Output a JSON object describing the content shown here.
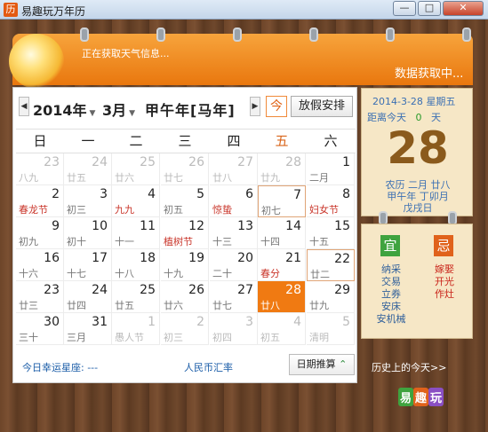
{
  "window": {
    "icon_char": "历",
    "title": "易趣玩万年历",
    "buttons": [
      "—",
      "□",
      "✕"
    ]
  },
  "header": {
    "weather_text": "正在获取天气信息...",
    "data_status": "数据获取中..."
  },
  "nav": {
    "year": "2014年",
    "month": "3月",
    "ganzhi": "甲午年[马年]",
    "prev": "◀",
    "next": "▶",
    "today_label": "今",
    "holiday_label": "放假安排"
  },
  "weekdays": [
    "日",
    "一",
    "二",
    "三",
    "四",
    "五",
    "六"
  ],
  "days": [
    {
      "num": "23",
      "sub": "八九",
      "other": true
    },
    {
      "num": "24",
      "sub": "廿五",
      "other": true
    },
    {
      "num": "25",
      "sub": "廿六",
      "other": true
    },
    {
      "num": "26",
      "sub": "廿七",
      "other": true
    },
    {
      "num": "27",
      "sub": "廿八",
      "other": true
    },
    {
      "num": "28",
      "sub": "廿九",
      "other": true
    },
    {
      "num": "1",
      "sub": "二月"
    },
    {
      "num": "2",
      "sub": "春龙节",
      "red": true
    },
    {
      "num": "3",
      "sub": "初三"
    },
    {
      "num": "4",
      "sub": "九九",
      "red": true
    },
    {
      "num": "5",
      "sub": "初五"
    },
    {
      "num": "6",
      "sub": "惊蛰",
      "red": true
    },
    {
      "num": "7",
      "sub": "初七",
      "box": true
    },
    {
      "num": "8",
      "sub": "妇女节",
      "red": true
    },
    {
      "num": "9",
      "sub": "初九"
    },
    {
      "num": "10",
      "sub": "初十"
    },
    {
      "num": "11",
      "sub": "十一"
    },
    {
      "num": "12",
      "sub": "植树节",
      "red": true
    },
    {
      "num": "13",
      "sub": "十三"
    },
    {
      "num": "14",
      "sub": "十四"
    },
    {
      "num": "15",
      "sub": "十五"
    },
    {
      "num": "16",
      "sub": "十六"
    },
    {
      "num": "17",
      "sub": "十七"
    },
    {
      "num": "18",
      "sub": "十八"
    },
    {
      "num": "19",
      "sub": "十九"
    },
    {
      "num": "20",
      "sub": "二十"
    },
    {
      "num": "21",
      "sub": "春分",
      "red": true
    },
    {
      "num": "22",
      "sub": "廿二",
      "box": true
    },
    {
      "num": "23",
      "sub": "廿三"
    },
    {
      "num": "24",
      "sub": "廿四"
    },
    {
      "num": "25",
      "sub": "廿五"
    },
    {
      "num": "26",
      "sub": "廿六"
    },
    {
      "num": "27",
      "sub": "廿七"
    },
    {
      "num": "28",
      "sub": "廿八",
      "today": true
    },
    {
      "num": "29",
      "sub": "廿九"
    },
    {
      "num": "30",
      "sub": "三十"
    },
    {
      "num": "31",
      "sub": "三月"
    },
    {
      "num": "1",
      "sub": "愚人节",
      "other": true
    },
    {
      "num": "2",
      "sub": "初三",
      "other": true
    },
    {
      "num": "3",
      "sub": "初四",
      "other": true
    },
    {
      "num": "4",
      "sub": "初五",
      "other": true
    },
    {
      "num": "5",
      "sub": "清明",
      "other": true
    }
  ],
  "footer": {
    "lucky": "今日幸运星座: ---",
    "currency": "人民币汇率",
    "datecalc": "日期推算",
    "history": "历史上的今天>>"
  },
  "day_panel": {
    "date": "2014-3-28",
    "weekday": "星期五",
    "countdown_label": "距离今天",
    "countdown_value": "0",
    "countdown_unit": "天",
    "big_day": "28",
    "lunar": "农历 二月 廿八",
    "ganzhi": "甲午年 丁卯月",
    "day_ganzhi": "戊戌日"
  },
  "yiji": {
    "yi_label": "宜",
    "ji_label": "忌",
    "yi": [
      "纳采",
      "交易",
      "立券",
      "安床",
      "安机械"
    ],
    "ji": [
      "嫁娶",
      "开光",
      "作灶"
    ]
  },
  "logo": [
    "易",
    "趣",
    "玩"
  ],
  "colors": {
    "accent": "#f07a12",
    "green": "#3fa33f",
    "red": "#e0621b",
    "link": "#1b5da8"
  }
}
